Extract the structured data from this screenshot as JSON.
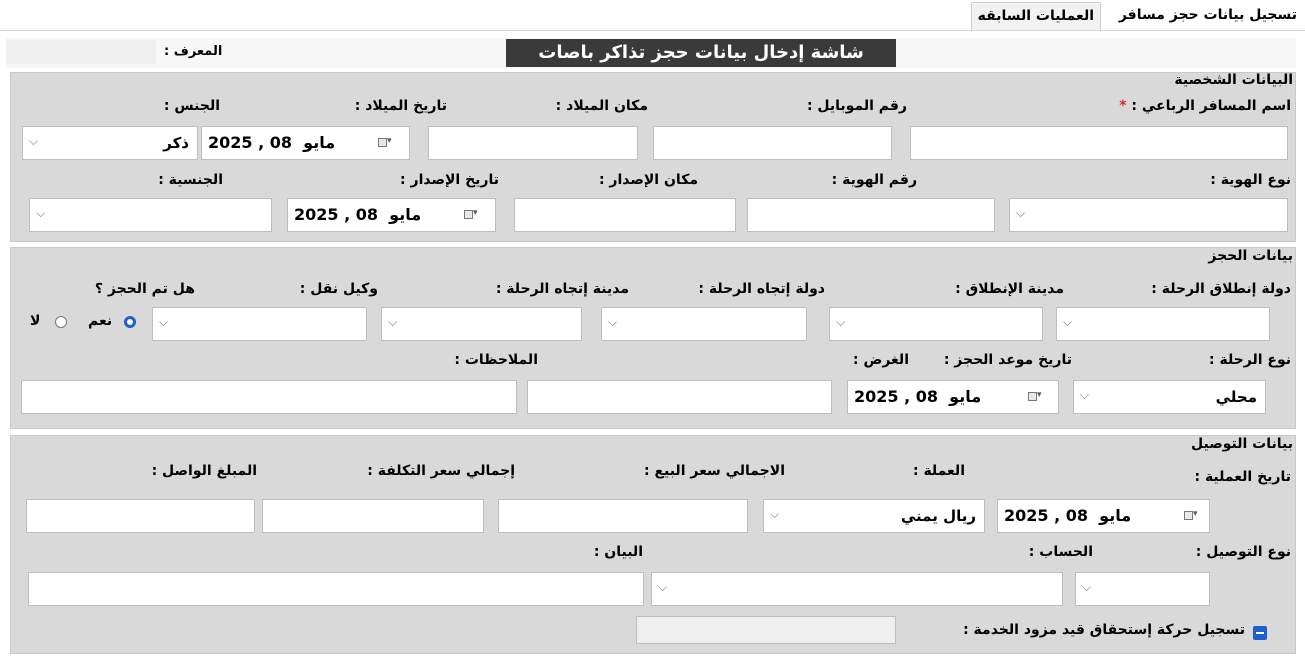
{
  "tabs": [
    {
      "label": "تسجيل بيانات حجز مسافر"
    },
    {
      "label": "العمليات السابقه"
    }
  ],
  "header": {
    "title": "شاشة إدخال بيانات حجز تذاكر باصات",
    "id_label": "المعرف :",
    "id_value": ""
  },
  "personal": {
    "title": "البيانات الشخصية",
    "name_label": "اسم المسافر الرباعي :",
    "required_mark": "*",
    "mobile_label": "رقم الموبايل :",
    "birth_place_label": "مكان الميلاد :",
    "birth_date_label": "تاريخ الميلاد :",
    "gender_label": "الجنس :",
    "birth_date": {
      "day": "08",
      "month": "مايو",
      "year": "2025"
    },
    "gender_value": "ذكر",
    "id_type_label": "نوع الهوية :",
    "id_number_label": "رقم الهوية :",
    "issue_place_label": "مكان الإصدار :",
    "issue_date_label": "تاريخ الإصدار :",
    "nationality_label": "الجنسية :",
    "issue_date": {
      "day": "08",
      "month": "مايو",
      "year": "2025"
    }
  },
  "booking": {
    "title": "بيانات الحجز",
    "departure_country_label": "دولة إنطلاق الرحلة :",
    "departure_city_label": "مدينة الإنطلاق :",
    "destination_country_label": "دولة إتجاه الرحلة :",
    "destination_city_label": "مدينة إتجاه الرحلة :",
    "agent_label": "وكيل نقل :",
    "booked_label": "هل تم الحجز ؟",
    "yes_label": "نعم",
    "no_label": "لا",
    "trip_type_label": "نوع الرحلة :",
    "trip_type_value": "محلي",
    "booking_date_label": "تاريخ موعد الحجز :",
    "booking_date": {
      "day": "08",
      "month": "مايو",
      "year": "2025"
    },
    "purpose_label": "الغرض :",
    "notes_label": "الملاحظات :"
  },
  "delivery": {
    "title": "بيانات التوصيل",
    "op_date_label": "تاريخ العملية :",
    "op_date": {
      "day": "08",
      "month": "مايو",
      "year": "2025"
    },
    "currency_label": "العملة :",
    "currency_value": "ريال يمني",
    "total_sale_label": "الاجمالي سعر البيع :",
    "total_cost_label": "إجمالي سعر التكلفة :",
    "received_label": "المبلغ الواصل :",
    "delivery_type_label": "نوع التوصيل :",
    "account_label": "الحساب :",
    "statement_label": "البيان :",
    "service_entry_label": "تسجيل حركة إستحقاق قيد مزود الخدمة :"
  }
}
